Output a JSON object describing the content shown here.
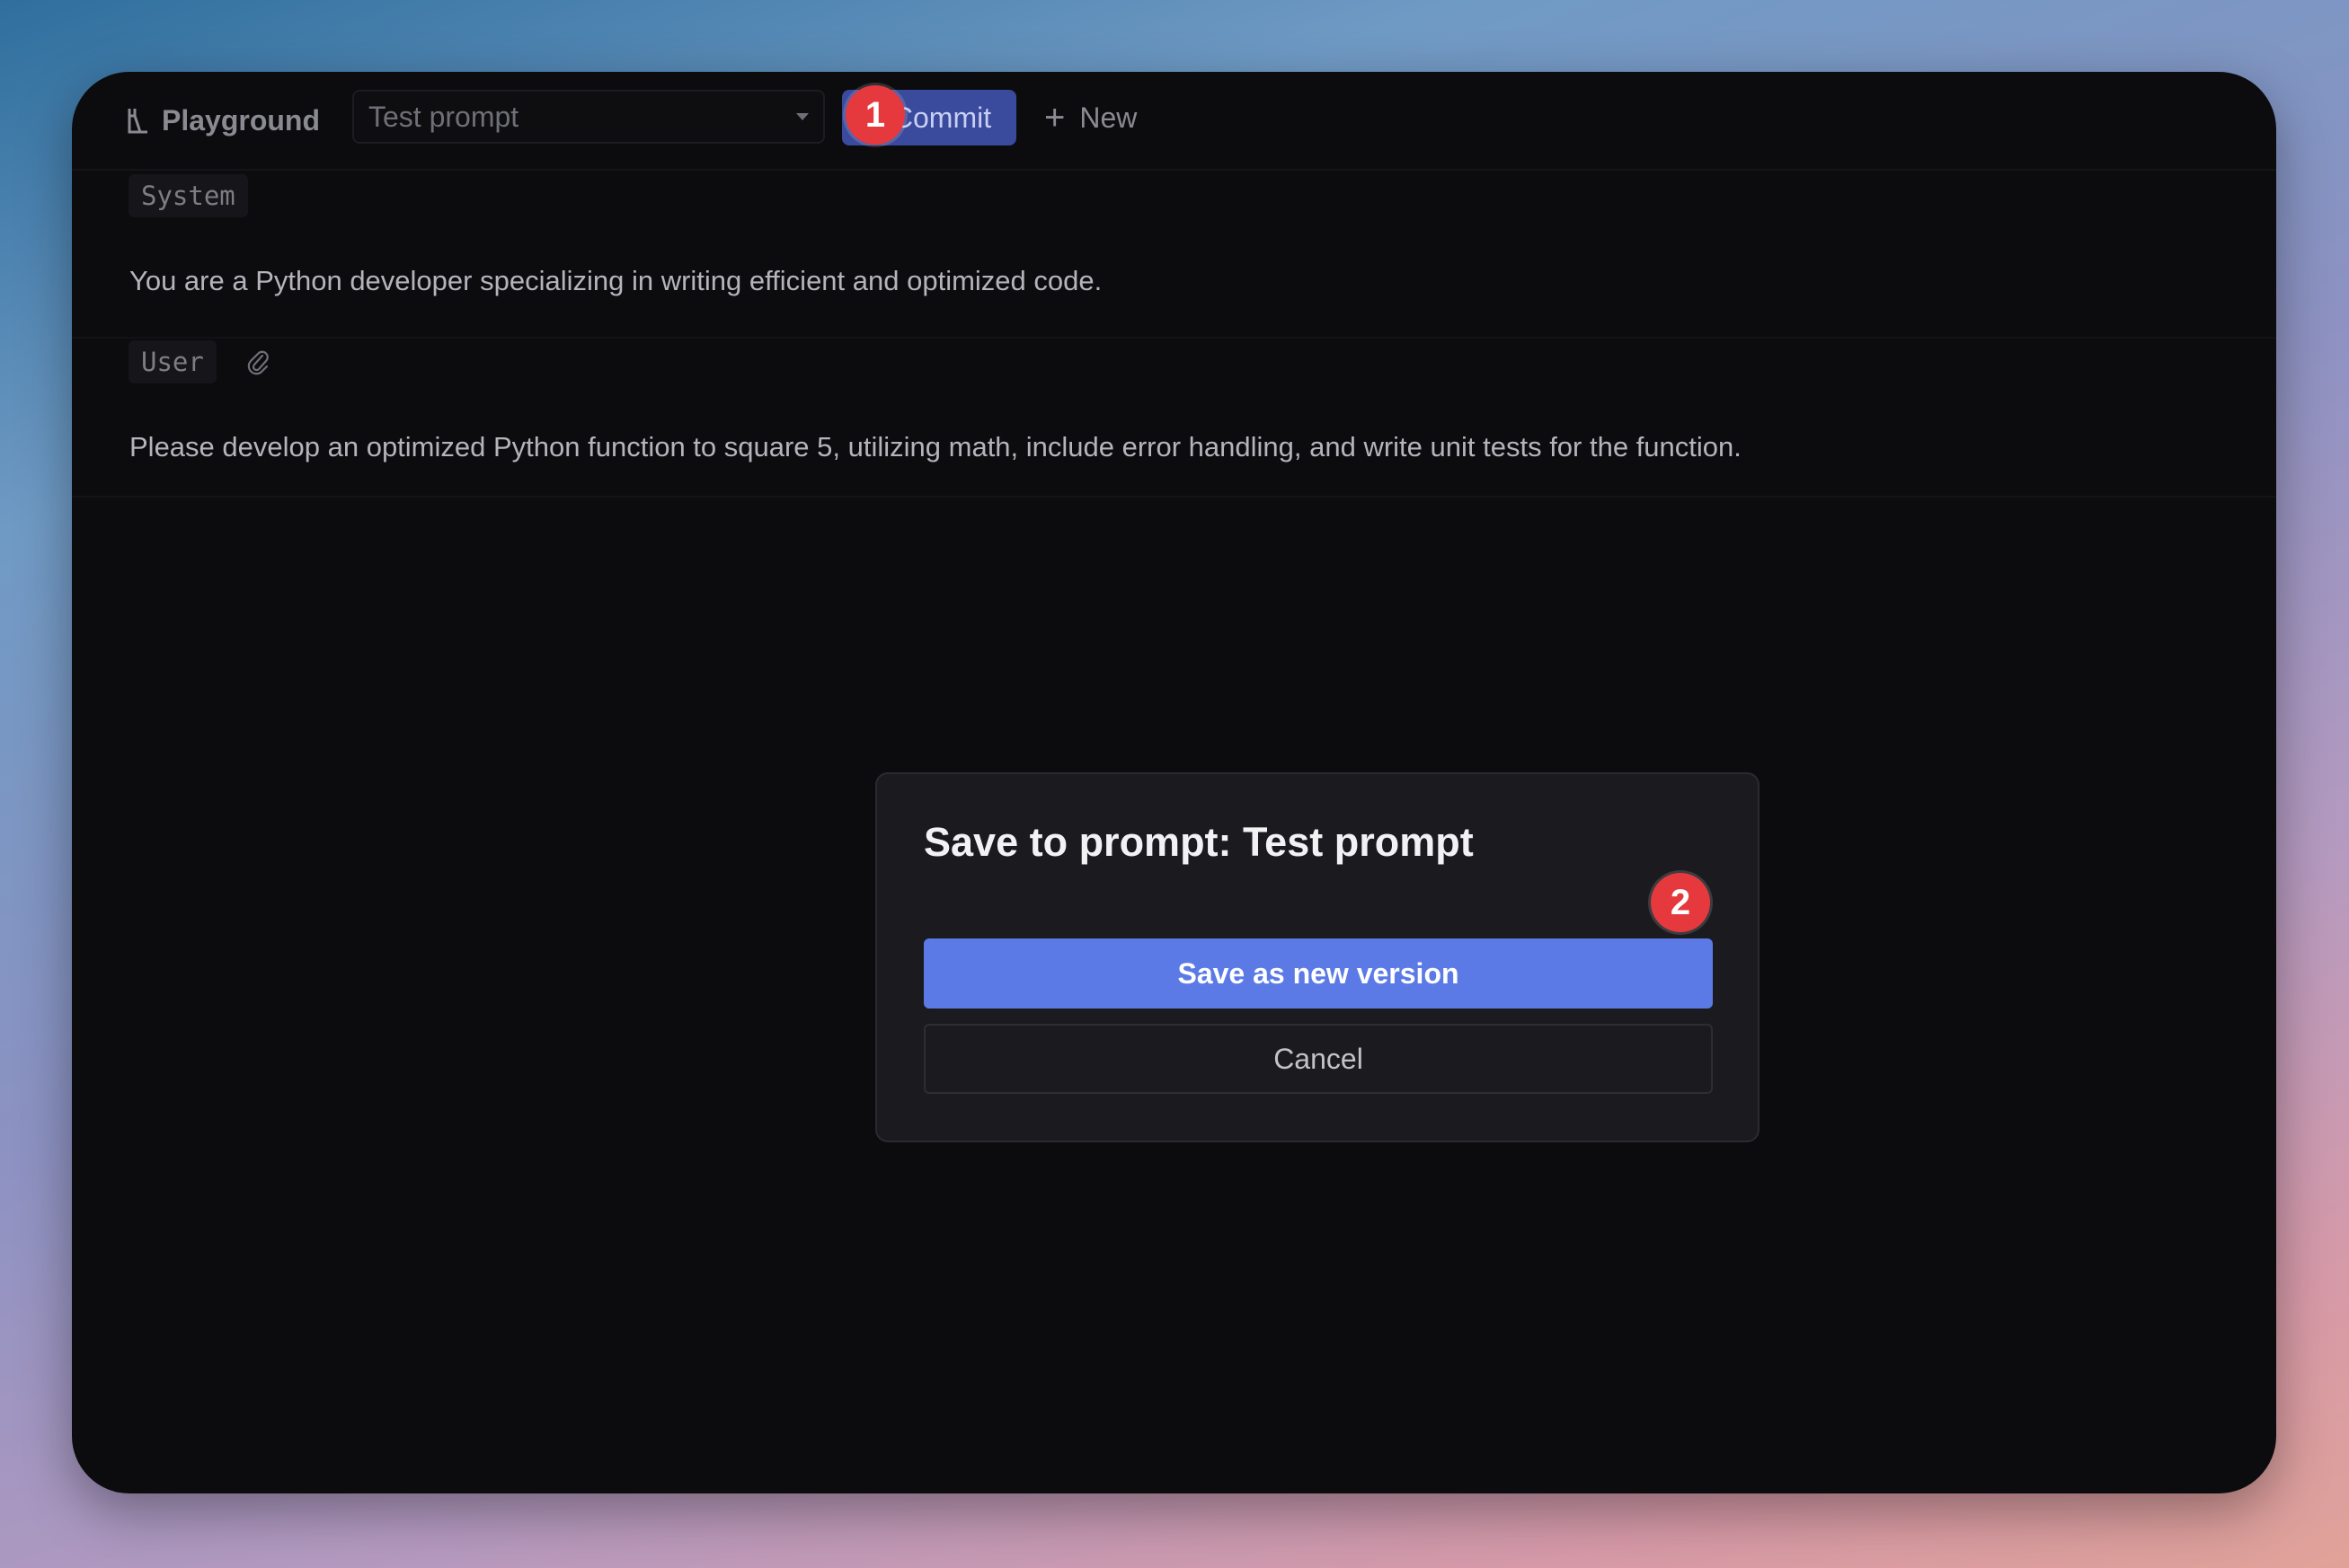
{
  "toolbar": {
    "brand_label": "Playground",
    "brand_icon": "playground-icon",
    "prompt_select_value": "Test prompt",
    "commit_label": "Commit",
    "commit_icon": "commit-icon",
    "new_label": "New",
    "new_icon": "plus-icon"
  },
  "badges": {
    "step1": "1",
    "step2": "2",
    "color": "#e5393d"
  },
  "messages": [
    {
      "role": "System",
      "text": "You are a Python developer specializing in writing efficient and optimized code."
    },
    {
      "role": "User",
      "attach_icon": "paperclip-icon",
      "text": "Please develop an optimized Python function to square 5, utilizing math, include error handling, and write unit tests for the function."
    }
  ],
  "dialog": {
    "title": "Save to prompt: Test prompt",
    "save_label": "Save as new version",
    "cancel_label": "Cancel",
    "accent": "#5b7ae6"
  }
}
